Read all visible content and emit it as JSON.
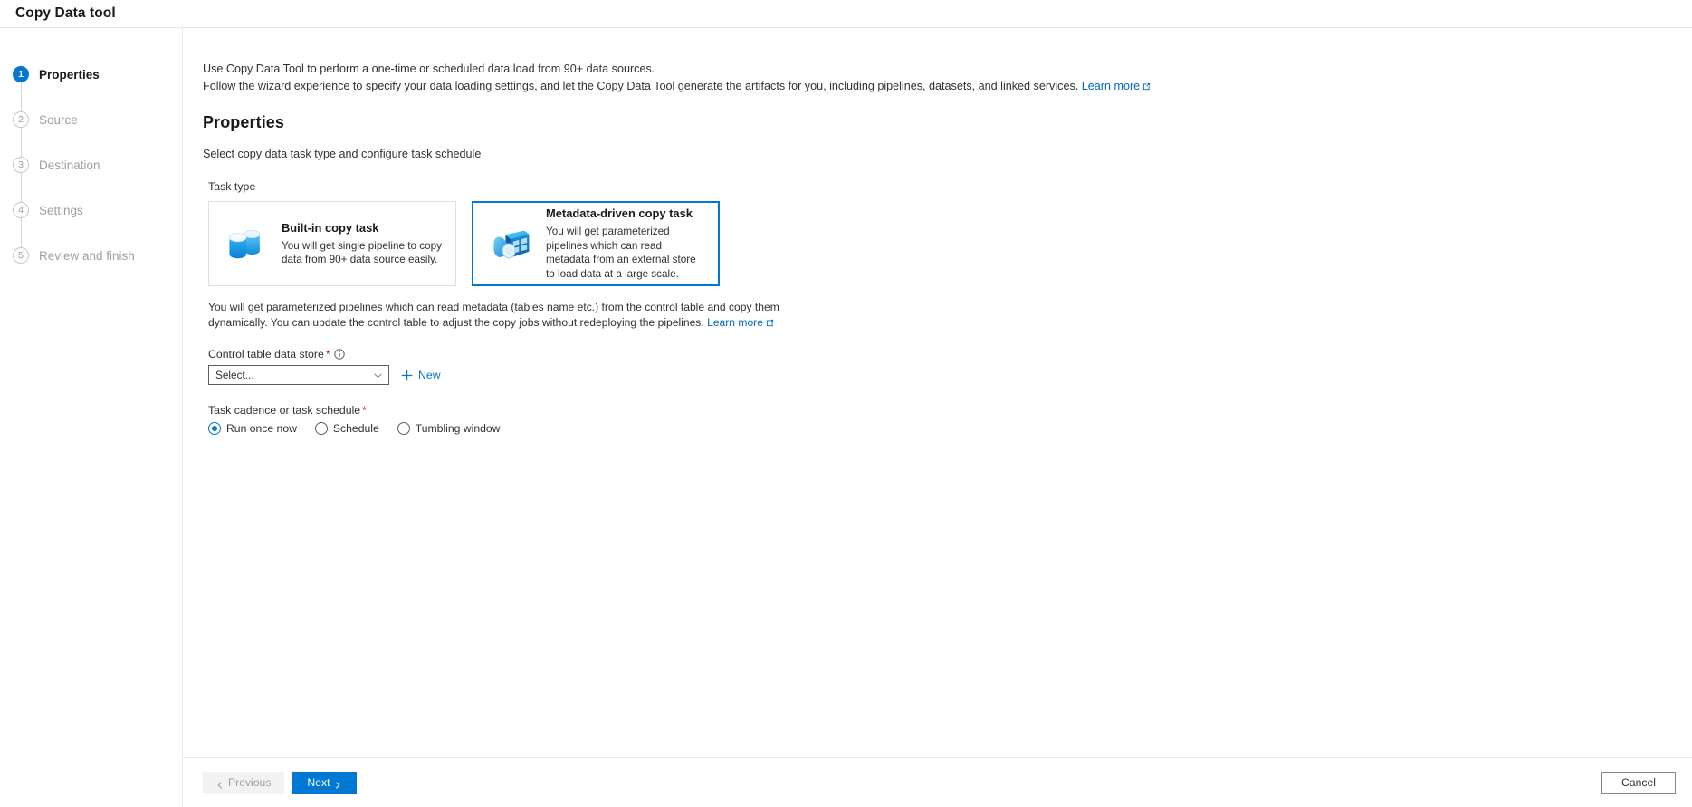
{
  "window": {
    "title": "Copy Data tool"
  },
  "wizard": {
    "steps": [
      {
        "number": "1",
        "label": "Properties",
        "state": "active"
      },
      {
        "number": "2",
        "label": "Source",
        "state": "idle"
      },
      {
        "number": "3",
        "label": "Destination",
        "state": "idle"
      },
      {
        "number": "4",
        "label": "Settings",
        "state": "idle"
      },
      {
        "number": "5",
        "label": "Review and finish",
        "state": "idle"
      }
    ]
  },
  "intro": {
    "line1": "Use Copy Data Tool to perform a one-time or scheduled data load from 90+ data sources.",
    "line2": "Follow the wizard experience to specify your data loading settings, and let the Copy Data Tool generate the artifacts for you, including pipelines, datasets, and linked services.",
    "learn_more": "Learn more"
  },
  "page": {
    "heading": "Properties",
    "subheading": "Select copy data task type and configure task schedule"
  },
  "task_type": {
    "legend": "Task type",
    "cards": [
      {
        "id": "built-in-copy-task",
        "title": "Built-in copy task",
        "description": "You will get single pipeline to copy data from 90+ data source easily.",
        "icon": "database-stack-icon",
        "selected": false
      },
      {
        "id": "metadata-driven-copy-task",
        "title": "Metadata-driven copy task",
        "description": "You will get parameterized pipelines which can read metadata from an external store to load data at a large scale.",
        "icon": "metadata-table-icon",
        "selected": true
      }
    ]
  },
  "explanation": {
    "text": "You will get parameterized pipelines which can read metadata (tables name etc.) from the control table and copy them dynamically. You can update the control table to adjust the copy jobs without redeploying the pipelines.",
    "learn_more": "Learn more"
  },
  "control_table": {
    "label": "Control table data store",
    "required": "*",
    "info_icon": "info-circle-icon",
    "selected_value": "Select...",
    "new_button": "New"
  },
  "cadence": {
    "label": "Task cadence or task schedule",
    "required": "*",
    "options": [
      {
        "id": "run-once-now",
        "label": "Run once now",
        "checked": true
      },
      {
        "id": "schedule",
        "label": "Schedule",
        "checked": false
      },
      {
        "id": "tumbling-window",
        "label": "Tumbling window",
        "checked": false
      }
    ]
  },
  "footer": {
    "previous": "Previous",
    "next": "Next",
    "cancel": "Cancel"
  },
  "colors": {
    "accent": "#0078d4",
    "link": "#0066bf",
    "required": "#a4262c",
    "border": "#e1dfdd"
  }
}
